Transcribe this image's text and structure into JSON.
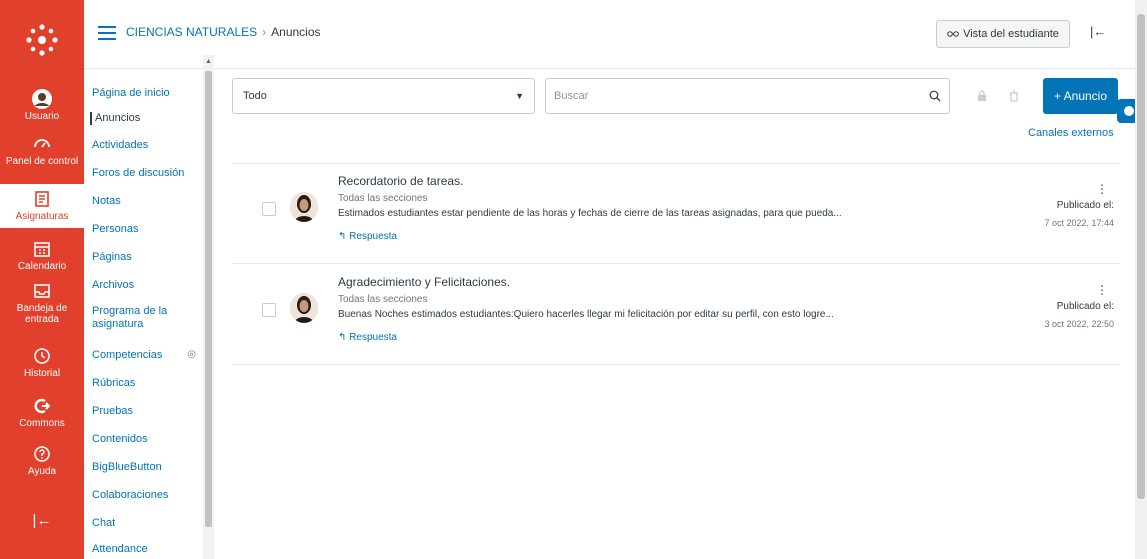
{
  "global_nav": {
    "items": [
      {
        "label": "Usuario",
        "icon": "user-icon"
      },
      {
        "label": "Panel de control",
        "icon": "dashboard-icon"
      },
      {
        "label": "Asignaturas",
        "icon": "courses-icon"
      },
      {
        "label": "Calendario",
        "icon": "calendar-icon"
      },
      {
        "label": "Bandeja de entrada",
        "icon": "inbox-icon"
      },
      {
        "label": "Historial",
        "icon": "history-icon"
      },
      {
        "label": "Commons",
        "icon": "commons-icon"
      },
      {
        "label": "Ayuda",
        "icon": "help-icon"
      }
    ],
    "collapse_glyph": "|←"
  },
  "header": {
    "course_link": "CIENCIAS NATURALES",
    "separator": "›",
    "current_page": "Anuncios",
    "student_view_label": "Vista del estudiante",
    "collapse_glyph": "|←"
  },
  "course_nav": {
    "items": [
      {
        "label": "Página de inicio"
      },
      {
        "label": "Anuncios",
        "active": true
      },
      {
        "label": "Actividades"
      },
      {
        "label": "Foros de discusión"
      },
      {
        "label": "Notas"
      },
      {
        "label": "Personas"
      },
      {
        "label": "Páginas"
      },
      {
        "label": "Archivos"
      },
      {
        "label": "Programa de la asignatura"
      },
      {
        "label": "Competencias"
      },
      {
        "label": "Rúbricas"
      },
      {
        "label": "Pruebas"
      },
      {
        "label": "Contenidos"
      },
      {
        "label": "BigBlueButton"
      },
      {
        "label": "Colaboraciones"
      },
      {
        "label": "Chat"
      },
      {
        "label": "Attendance"
      }
    ]
  },
  "toolbar": {
    "filter_value": "Todo",
    "search_placeholder": "Buscar",
    "add_button_label": "+ Anuncio",
    "external_feeds_label": "Canales externos"
  },
  "announcements": [
    {
      "title": "Recordatorio de tareas.",
      "sections": "Todas las secciones",
      "message": "Estimados estudiantes estar pendiente de las horas y fechas de cierre de las tareas asignadas, para que pueda...",
      "reply_label": "Respuesta",
      "posted_label": "Publicado el:",
      "posted_date": "7 oct 2022, 17:44"
    },
    {
      "title": "Agradecimiento y Felicitaciones.",
      "sections": "Todas las secciones",
      "message": "Buenas Noches estimados estudiantes:Quiero hacerles llegar mi felicitación por editar su perfil, con esto logre...",
      "reply_label": "Respuesta",
      "posted_label": "Publicado el:",
      "posted_date": "3 oct 2022, 22:50"
    }
  ],
  "colors": {
    "brand_red": "#e0402c",
    "link_blue": "#0374b5"
  }
}
